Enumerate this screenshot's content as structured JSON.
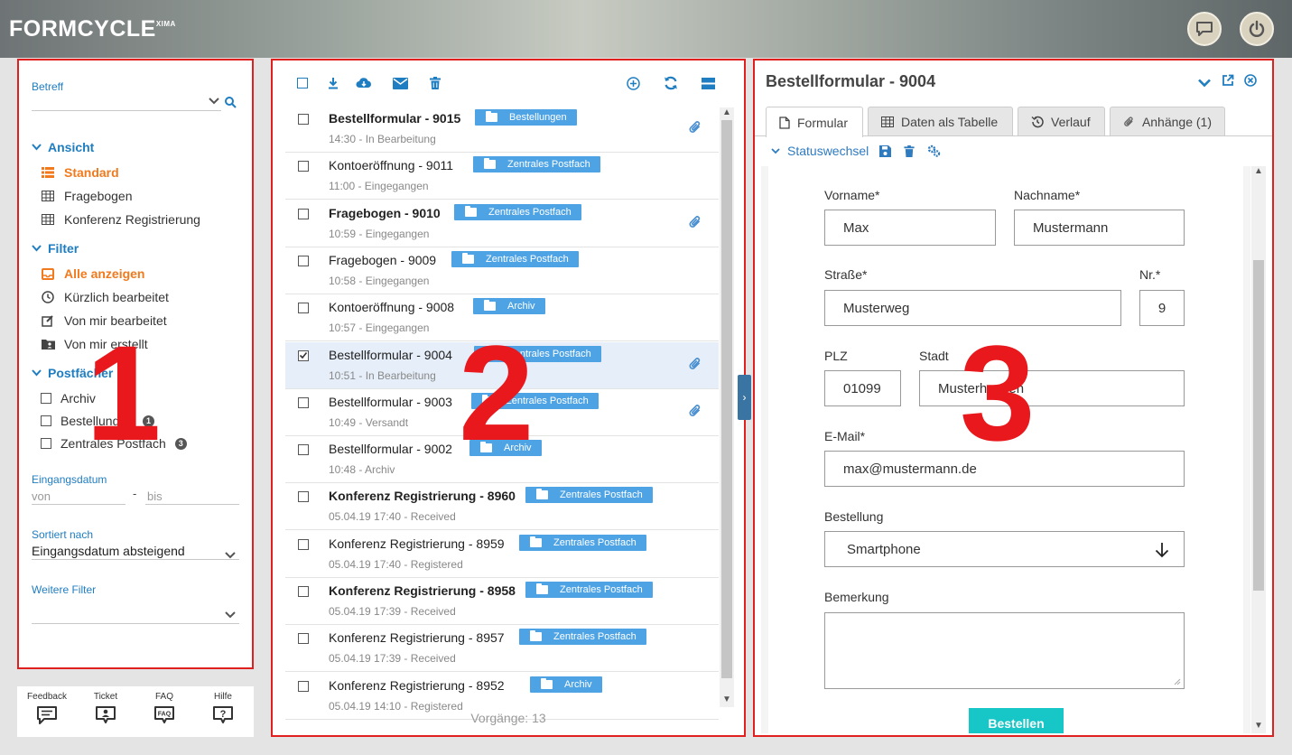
{
  "header": {
    "logo": "FORMCYCLE",
    "logo_sup": "XIMA",
    "feedback_icon": "chat-icon",
    "power_icon": "power-icon"
  },
  "annotations": {
    "n1": "1",
    "n2": "2",
    "n3": "3"
  },
  "panel1": {
    "betreff_label": "Betreff",
    "ansicht_label": "Ansicht",
    "ansicht_items": [
      {
        "label": "Standard",
        "icon": "list-icon",
        "active": true
      },
      {
        "label": "Fragebogen",
        "icon": "table-icon",
        "active": false
      },
      {
        "label": "Konferenz Registrierung",
        "icon": "table-icon",
        "active": false
      }
    ],
    "filter_label": "Filter",
    "filter_items": [
      {
        "label": "Alle anzeigen",
        "icon": "inbox-icon",
        "active": true
      },
      {
        "label": "Kürzlich bearbeitet",
        "icon": "clock-icon",
        "active": false
      },
      {
        "label": "Von mir bearbeitet",
        "icon": "edit-icon",
        "active": false
      },
      {
        "label": "Von mir erstellt",
        "icon": "folder-user-icon",
        "active": false
      }
    ],
    "postfaecher_label": "Postfächer",
    "postfaecher_count": "3",
    "postfaecher": [
      {
        "label": "Archiv",
        "count": ""
      },
      {
        "label": "Bestellungen",
        "count": "1"
      },
      {
        "label": "Zentrales Postfach",
        "count": "3"
      }
    ],
    "eingangsdatum_label": "Eingangsdatum",
    "von_placeholder": "von",
    "dash": "-",
    "bis_placeholder": "bis",
    "sortiert_label": "Sortiert nach",
    "sortiert_value": "Eingangsdatum absteigend",
    "weitere_label": "Weitere Filter"
  },
  "bottombar": {
    "items": [
      {
        "label": "Feedback",
        "icon": "feedback-icon"
      },
      {
        "label": "Ticket",
        "icon": "ticket-icon"
      },
      {
        "label": "FAQ",
        "icon": "faq-icon",
        "icon_text": "FAQ"
      },
      {
        "label": "Hilfe",
        "icon": "help-icon",
        "icon_text": "?"
      }
    ]
  },
  "panel2": {
    "rows": [
      {
        "title": "Bestellformular - 9015",
        "bold": true,
        "sub": "14:30 - In Bearbeitung",
        "tag": "Bestellungen",
        "attachment": true,
        "checked": false,
        "selected": false
      },
      {
        "title": "Kontoeröffnung - 9011",
        "bold": false,
        "sub": "11:00 - Eingegangen",
        "tag": "Zentrales Postfach",
        "attachment": false,
        "checked": false,
        "selected": false
      },
      {
        "title": "Fragebogen - 9010",
        "bold": true,
        "sub": "10:59 - Eingegangen",
        "tag": "Zentrales Postfach",
        "attachment": true,
        "checked": false,
        "selected": false
      },
      {
        "title": "Fragebogen - 9009",
        "bold": false,
        "sub": "10:58 - Eingegangen",
        "tag": "Zentrales Postfach",
        "attachment": false,
        "checked": false,
        "selected": false
      },
      {
        "title": "Kontoeröffnung - 9008",
        "bold": false,
        "sub": "10:57 - Eingegangen",
        "tag": "Archiv",
        "attachment": false,
        "checked": false,
        "selected": false
      },
      {
        "title": "Bestellformular - 9004",
        "bold": false,
        "sub": "10:51 - In Bearbeitung",
        "tag": "Zentrales Postfach",
        "attachment": true,
        "checked": true,
        "selected": true
      },
      {
        "title": "Bestellformular - 9003",
        "bold": false,
        "sub": "10:49 - Versandt",
        "tag": "Zentrales Postfach",
        "attachment": true,
        "checked": false,
        "selected": false
      },
      {
        "title": "Bestellformular - 9002",
        "bold": false,
        "sub": "10:48 - Archiv",
        "tag": "Archiv",
        "attachment": false,
        "checked": false,
        "selected": false
      },
      {
        "title": "Konferenz Registrierung - 8960",
        "bold": true,
        "sub": "05.04.19 17:40 - Received",
        "tag": "Zentrales Postfach",
        "attachment": false,
        "checked": false,
        "selected": false
      },
      {
        "title": "Konferenz Registrierung - 8959",
        "bold": false,
        "sub": "05.04.19 17:40 - Registered",
        "tag": "Zentrales Postfach",
        "attachment": false,
        "checked": false,
        "selected": false
      },
      {
        "title": "Konferenz Registrierung - 8958",
        "bold": true,
        "sub": "05.04.19 17:39 - Received",
        "tag": "Zentrales Postfach",
        "attachment": false,
        "checked": false,
        "selected": false
      },
      {
        "title": "Konferenz Registrierung - 8957",
        "bold": false,
        "sub": "05.04.19 17:39 - Received",
        "tag": "Zentrales Postfach",
        "attachment": false,
        "checked": false,
        "selected": false
      },
      {
        "title": "Konferenz Registrierung - 8952",
        "bold": false,
        "sub": "05.04.19 14:10 - Registered",
        "tag": "Archiv",
        "attachment": false,
        "checked": false,
        "selected": false
      }
    ],
    "footer": "Vorgänge: 13"
  },
  "panel3": {
    "title": "Bestellformular - 9004",
    "tabs": [
      "Formular",
      "Daten als Tabelle",
      "Verlauf",
      "Anhänge (1)"
    ],
    "status_label": "Statuswechsel",
    "form": {
      "vorname_label": "Vorname*",
      "vorname": "Max",
      "nachname_label": "Nachname*",
      "nachname": "Mustermann",
      "strasse_label": "Straße*",
      "strasse": "Musterweg",
      "nr_label": "Nr.*",
      "nr": "9",
      "plz_label": "PLZ",
      "plz": "01099",
      "stadt_label": "Stadt",
      "stadt": "Musterhausen",
      "email_label": "E-Mail*",
      "email": "max@mustermann.de",
      "bestellung_label": "Bestellung",
      "bestellung": "Smartphone",
      "bemerkung_label": "Bemerkung",
      "submit": "Bestellen"
    }
  },
  "colors": {
    "accent_blue": "#1f7dc1",
    "active_orange": "#f07a1d",
    "tag_blue": "#4ea3e5",
    "submit_teal": "#17c6c6",
    "annotation_red": "#e8181c"
  }
}
